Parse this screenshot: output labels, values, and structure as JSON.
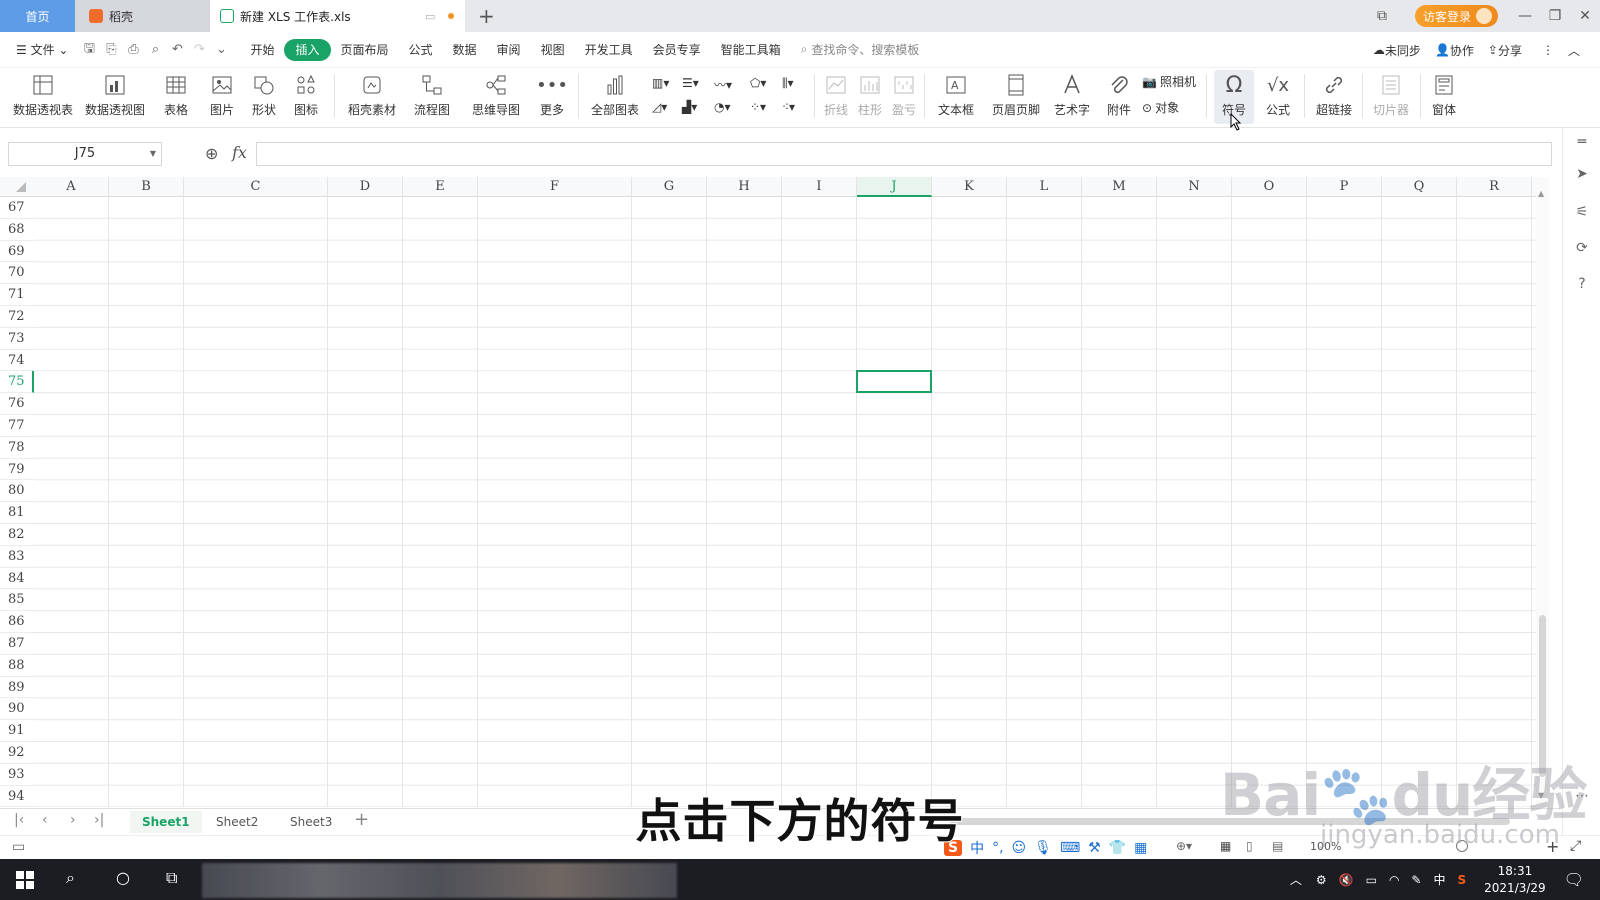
{
  "tabs": {
    "home": "首页",
    "docer": "稻壳",
    "file": "新建 XLS 工作表.xls",
    "add": "+"
  },
  "header": {
    "login": "访客登录"
  },
  "menu": {
    "file": "文件",
    "items": [
      "开始",
      "插入",
      "页面布局",
      "公式",
      "数据",
      "审阅",
      "视图",
      "开发工具",
      "会员专享",
      "智能工具箱"
    ],
    "active": "插入",
    "search_placeholder": "查找命令、搜索模板",
    "sync": "未同步",
    "collab": "协作",
    "share": "分享"
  },
  "ribbon": {
    "pivot_table": "数据透视表",
    "pivot_chart": "数据透视图",
    "table": "表格",
    "picture": "图片",
    "shape": "形状",
    "icon": "图标",
    "docer_material": "稻壳素材",
    "flowchart": "流程图",
    "mindmap": "思维导图",
    "more": "更多",
    "all_charts": "全部图表",
    "spark_line": "折线",
    "spark_column": "柱形",
    "spark_winloss": "盈亏",
    "textbox": "文本框",
    "header_footer": "页眉页脚",
    "wordart": "艺术字",
    "attachment": "附件",
    "camera": "照相机",
    "object": "对象",
    "symbol": "符号",
    "formula": "公式",
    "hyperlink": "超链接",
    "slicer": "切片器",
    "form": "窗体"
  },
  "formula_bar": {
    "name_box": "J75",
    "fx": "fx",
    "value": ""
  },
  "grid": {
    "columns": [
      "A",
      "B",
      "C",
      "D",
      "E",
      "F",
      "G",
      "H",
      "I",
      "J",
      "K",
      "L",
      "M",
      "N",
      "O",
      "P",
      "Q",
      "R"
    ],
    "rows": [
      "67",
      "68",
      "69",
      "70",
      "71",
      "72",
      "73",
      "74",
      "75",
      "76",
      "77",
      "78",
      "79",
      "80",
      "81",
      "82",
      "83",
      "84",
      "85",
      "86",
      "87",
      "88",
      "89",
      "90",
      "91",
      "92",
      "93",
      "94"
    ],
    "active_column": "J",
    "active_row": "75"
  },
  "sheets": {
    "names": [
      "Sheet1",
      "Sheet2",
      "Sheet3"
    ],
    "active": "Sheet1",
    "add": "+"
  },
  "status": {
    "zoom": "100%"
  },
  "taskbar": {
    "time": "18:31",
    "date": "2021/3/29",
    "ime": "中"
  },
  "overlay": {
    "subtitle": "点击下方的符号",
    "watermark": "Bai",
    "watermark_tail": "du经验",
    "watermark_url": "jingyan.baidu.com"
  },
  "colors": {
    "accent_green": "#1aa366",
    "home_tab": "#5f9ce8",
    "login_orange": "#f39324"
  }
}
